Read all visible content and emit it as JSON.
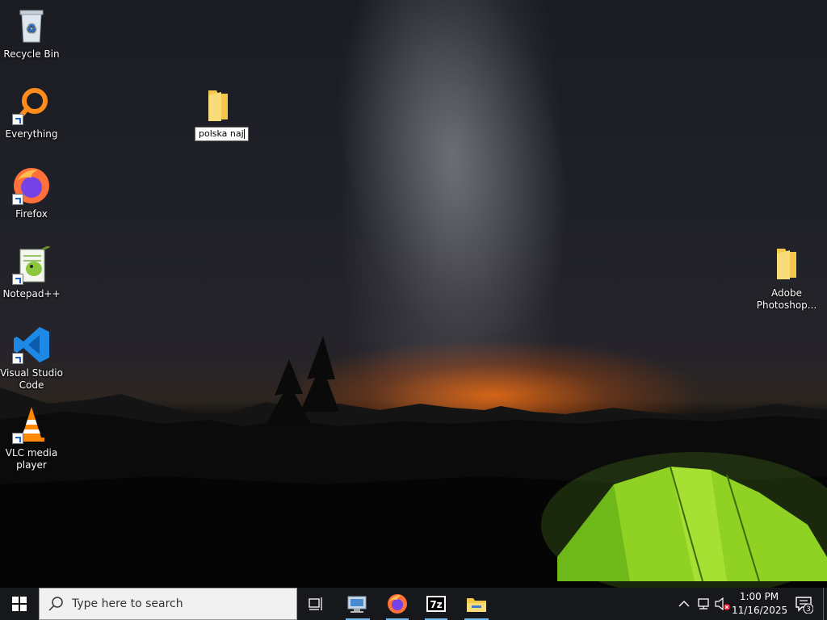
{
  "desktop": {
    "icons": [
      {
        "label": "Recycle Bin"
      },
      {
        "label": "Everything"
      },
      {
        "label": "Firefox"
      },
      {
        "label": "Notepad++"
      },
      {
        "label": "Visual Studio Code"
      },
      {
        "label": "VLC media player"
      },
      {
        "label": "Adobe Photoshop..."
      }
    ],
    "rename_folder": {
      "value": "polska naj"
    }
  },
  "taskbar": {
    "search_placeholder": "Type here to search",
    "pinned": [
      "task-view",
      "control-panel",
      "firefox",
      "7-zip",
      "file-explorer"
    ],
    "clock": {
      "time": "1:00 PM",
      "date": "11/16/2025"
    },
    "notifications_count": "3"
  },
  "colors": {
    "taskbar_bg": "#17181c",
    "accent": "#76b9ed",
    "folder": "#f4c94b"
  }
}
